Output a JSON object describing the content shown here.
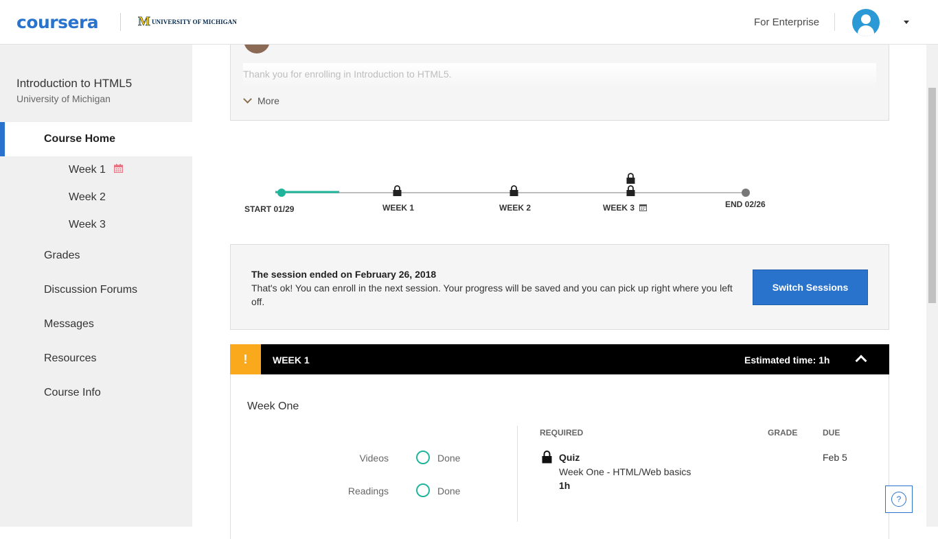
{
  "header": {
    "logo": "coursera",
    "partner": {
      "mark": "M",
      "name": "UNIVERSITY OF MICHIGAN"
    },
    "enterprise_link": "For Enterprise"
  },
  "sidebar": {
    "course_title": "Introduction to HTML5",
    "course_org": "University of Michigan",
    "home": "Course Home",
    "weeks": [
      "Week 1",
      "Week 2",
      "Week 3"
    ],
    "items": [
      "Grades",
      "Discussion Forums",
      "Messages",
      "Resources",
      "Course Info"
    ]
  },
  "announcement": {
    "text": "Thank you for enrolling in Introduction to HTML5.",
    "more": "More"
  },
  "timeline": {
    "start": "START 01/29",
    "week1": "WEEK 1",
    "week2": "WEEK 2",
    "week3": "WEEK 3",
    "end": "END 02/26"
  },
  "session": {
    "title": "The session ended on February 26, 2018",
    "body": "That's ok! You can enroll in the next session. Your progress will be saved and you can pick up right where you left off.",
    "button": "Switch Sessions"
  },
  "week": {
    "warning": "!",
    "title": "WEEK 1",
    "estimated": "Estimated time: 1h",
    "subtitle": "Week One",
    "progress": [
      {
        "label": "Videos",
        "status": "Done"
      },
      {
        "label": "Readings",
        "status": "Done"
      }
    ],
    "columns": {
      "required": "REQUIRED",
      "grade": "GRADE",
      "due": "DUE"
    },
    "item": {
      "type": "Quiz",
      "name": "Week One - HTML/Web basics",
      "time": "1h",
      "due": "Feb 5"
    }
  },
  "help": "?",
  "colors": {
    "accent": "#2a73cc",
    "warning": "#f9a91b",
    "progress": "#1fb59a"
  }
}
